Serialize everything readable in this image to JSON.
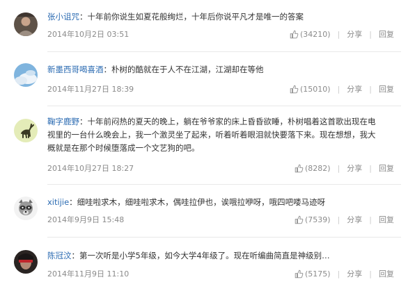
{
  "comments": [
    {
      "username": "张小诅咒",
      "separator": "：",
      "content": "十年前你说生如夏花般绚烂，十年后你说平凡才是唯一的答案",
      "time": "2014年10月2日 03:51",
      "likes": "(34210)",
      "share": "分享",
      "reply": "回复",
      "avatar_icon": "avatar-icon-person"
    },
    {
      "username": "新墨西哥喝喜酒",
      "separator": "：",
      "content": "朴树的酷就在于人不在江湖，江湖却在等他",
      "time": "2014年11月27日 18:39",
      "likes": "(15010)",
      "share": "分享",
      "reply": "回复",
      "avatar_icon": "avatar-icon-sky"
    },
    {
      "username": "鞠字鹿野",
      "separator": "：",
      "content": "十年前闷热的夏天的晚上，躺在爷爷家的床上昏昏欲睡，朴树唱着这首歌出现在电视里的一台什么晚会上，我一个激灵坐了起来，听着听着眼泪就快要落下来。现在想想，我大概就是在那个时候堕落成一个文艺狗的吧。",
      "content_lines": [
        "十年前闷热的夏天的晚上，躺在爷爷家的床上昏昏欲睡，朴树唱着这首歌出现在电",
        "视里的一台什么晚会上，我一个激灵坐了起来，听着听着眼泪就快要落下来。现在想想，我大",
        "概就是在那个时候堕落成一个文艺狗的吧。"
      ],
      "time": "2014年10月27日 18:27",
      "likes": "(8282)",
      "share": "分享",
      "reply": "回复",
      "avatar_icon": "avatar-icon-deer"
    },
    {
      "username": "xitijie",
      "separator": "：",
      "content": "细哇啦求木，细哇啦求木，偶哇拉伊也，诶哦拉咿呀，哦四吧喽马迹呀",
      "time": "2014年9月9日 15:48",
      "likes": "(7539)",
      "share": "分享",
      "reply": "回复",
      "avatar_icon": "avatar-icon-raccoon"
    },
    {
      "username": "陈冠汶",
      "separator": "：",
      "content": "第一次听是小学5年级，如今大学4年级了。现在听编曲简直是神级别…",
      "time": "2014年11月9日 11:10",
      "likes": "(5175)",
      "share": "分享",
      "reply": "回复",
      "avatar_icon": "avatar-icon-person-red"
    }
  ],
  "colors": {
    "username": "#2b6bb2",
    "text": "#333333",
    "meta": "#8a8a8a"
  }
}
